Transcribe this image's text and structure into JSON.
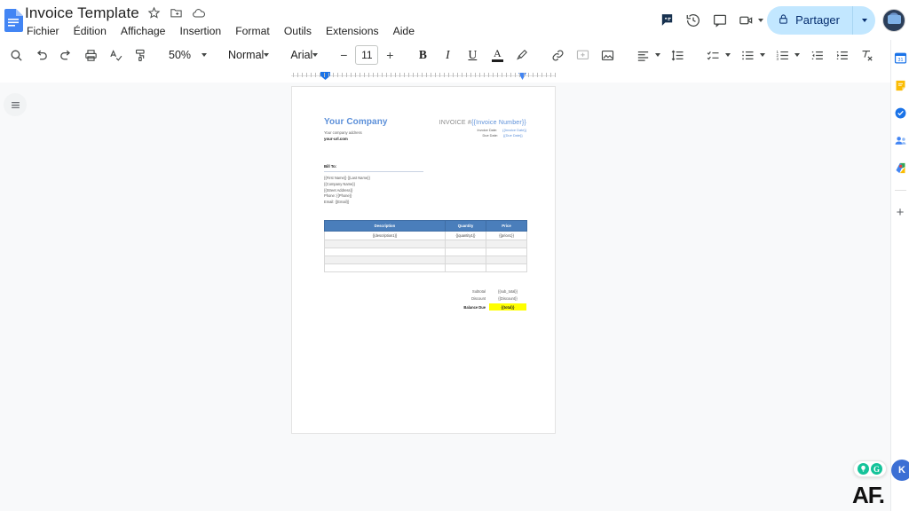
{
  "app": {
    "doc_title": "Invoice Template",
    "title_icons": [
      "star-icon",
      "move-to-folder-icon",
      "cloud-saved-icon"
    ],
    "menus": [
      "Fichier",
      "Édition",
      "Affichage",
      "Insertion",
      "Format",
      "Outils",
      "Extensions",
      "Aide"
    ],
    "accent_blue": "#1a73e8",
    "share_bg": "#c2e7ff"
  },
  "top_right": {
    "grammarly_label": "grammarly-icon",
    "history_label": "version-history-icon",
    "comment_label": "comment-icon",
    "meet_label": "meet-camera-icon",
    "share_label": "Partager",
    "avatar_label": "account-avatar"
  },
  "toolbar": {
    "search": "search-icon",
    "undo": "undo-icon",
    "redo": "redo-icon",
    "print": "print-icon",
    "spellcheck": "spellcheck-icon",
    "paint_format": "paint-format-icon",
    "zoom_value": "50%",
    "style_value": "Normal",
    "font_value": "Arial",
    "font_size": "11",
    "bold": "B",
    "italic": "I",
    "underline": "U",
    "text_color": "A",
    "highlight": "highlight-icon",
    "link": "link-icon",
    "comment": "add-comment-icon",
    "image": "insert-image-icon",
    "align": "align-left-icon",
    "line_spacing": "line-spacing-icon",
    "checklist": "checklist-icon",
    "bullets": "bulleted-list-icon",
    "numbered": "numbered-list-icon",
    "indent_less": "decrease-indent-icon",
    "indent_more": "increase-indent-icon",
    "clear_format": "clear-formatting-icon",
    "page_break": "page-break-icon",
    "edit_mode": "editing-mode-pen-icon",
    "collapse": "collapse-toolbar-icon"
  },
  "canvas": {
    "outline_toggle": "show-document-outline-icon",
    "ruler_indent_left": "left-indent-marker",
    "ruler_indent_right": "right-indent-marker"
  },
  "document": {
    "company_name": "Your Company",
    "company_address": "Your company address",
    "company_url": "your-url.com",
    "invoice_title_prefix": "INVOICE #",
    "invoice_number_token": "{{Invoice Number}}",
    "invoice_date_label": "Invoice Date:",
    "invoice_date_token": "{{Invoice Date}}",
    "due_date_label": "Due Date:",
    "due_date_token": "{{Due Date}}",
    "bill_to_label": "Bill To:",
    "bill_to_lines": [
      "{{First Name}} {{Last Name}}",
      "{{Company Name}}",
      "{{Street Address}}",
      "Phone: {{Phone}}",
      "Email: {{Email}}"
    ],
    "table": {
      "headers": [
        "Description",
        "Quantity",
        "Price"
      ],
      "rows": [
        [
          "{{description1}}",
          "{{quantity1}}",
          "{{price1}}"
        ],
        [
          "",
          "",
          ""
        ],
        [
          "",
          "",
          ""
        ],
        [
          "",
          "",
          ""
        ],
        [
          "",
          "",
          ""
        ]
      ],
      "header_bg": "#4a7ebb"
    },
    "totals": [
      {
        "label": "Subtotal",
        "value": "{{sub_total}}"
      },
      {
        "label": "Discount",
        "value": "{{Discount}}"
      },
      {
        "label": "Balance Due",
        "value": "{{total}}"
      }
    ],
    "balance_highlight": "#ffff00"
  },
  "side_panel": {
    "items": [
      {
        "name": "google-calendar-icon",
        "color": "#1a73e8"
      },
      {
        "name": "google-keep-icon",
        "color": "#fbbc04"
      },
      {
        "name": "google-tasks-icon",
        "color": "#1a73e8"
      },
      {
        "name": "google-contacts-icon",
        "color": "#1a73e8"
      },
      {
        "name": "google-maps-icon",
        "color": "#34a853"
      },
      {
        "name": "get-add-ons-icon",
        "label": "+"
      }
    ]
  },
  "widgets": {
    "grammarly_bulb": "grammarly-suggestion-icon",
    "grammarly_logo": "G",
    "profile_initial": "K",
    "watermark": "AF.",
    "watermark_sub": ""
  }
}
